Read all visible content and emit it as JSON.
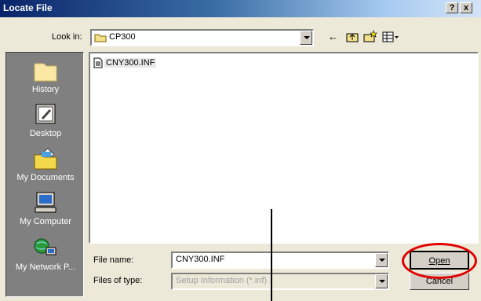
{
  "window": {
    "title": "Locate File",
    "help_btn": "?",
    "close_btn": "x"
  },
  "lookin": {
    "label": "Look in:",
    "value": "CP300"
  },
  "places": [
    {
      "label": "History",
      "icon": "history-icon"
    },
    {
      "label": "Desktop",
      "icon": "desktop-icon"
    },
    {
      "label": "My Documents",
      "icon": "my-documents-icon"
    },
    {
      "label": "My Computer",
      "icon": "my-computer-icon"
    },
    {
      "label": "My Network P...",
      "icon": "my-network-places-icon"
    }
  ],
  "files": [
    {
      "name": "CNY300.INF",
      "icon": "inf-file-icon"
    }
  ],
  "filename": {
    "label": "File name:",
    "value": "CNY300.INF"
  },
  "filetype": {
    "label": "Files of type:",
    "value": "Setup Information (*.inf)"
  },
  "buttons": {
    "open": "Open",
    "cancel": "Cancel"
  },
  "colors": {
    "highlight": "#e00000",
    "title_start": "#0a246a",
    "title_end": "#d4e4f7"
  }
}
